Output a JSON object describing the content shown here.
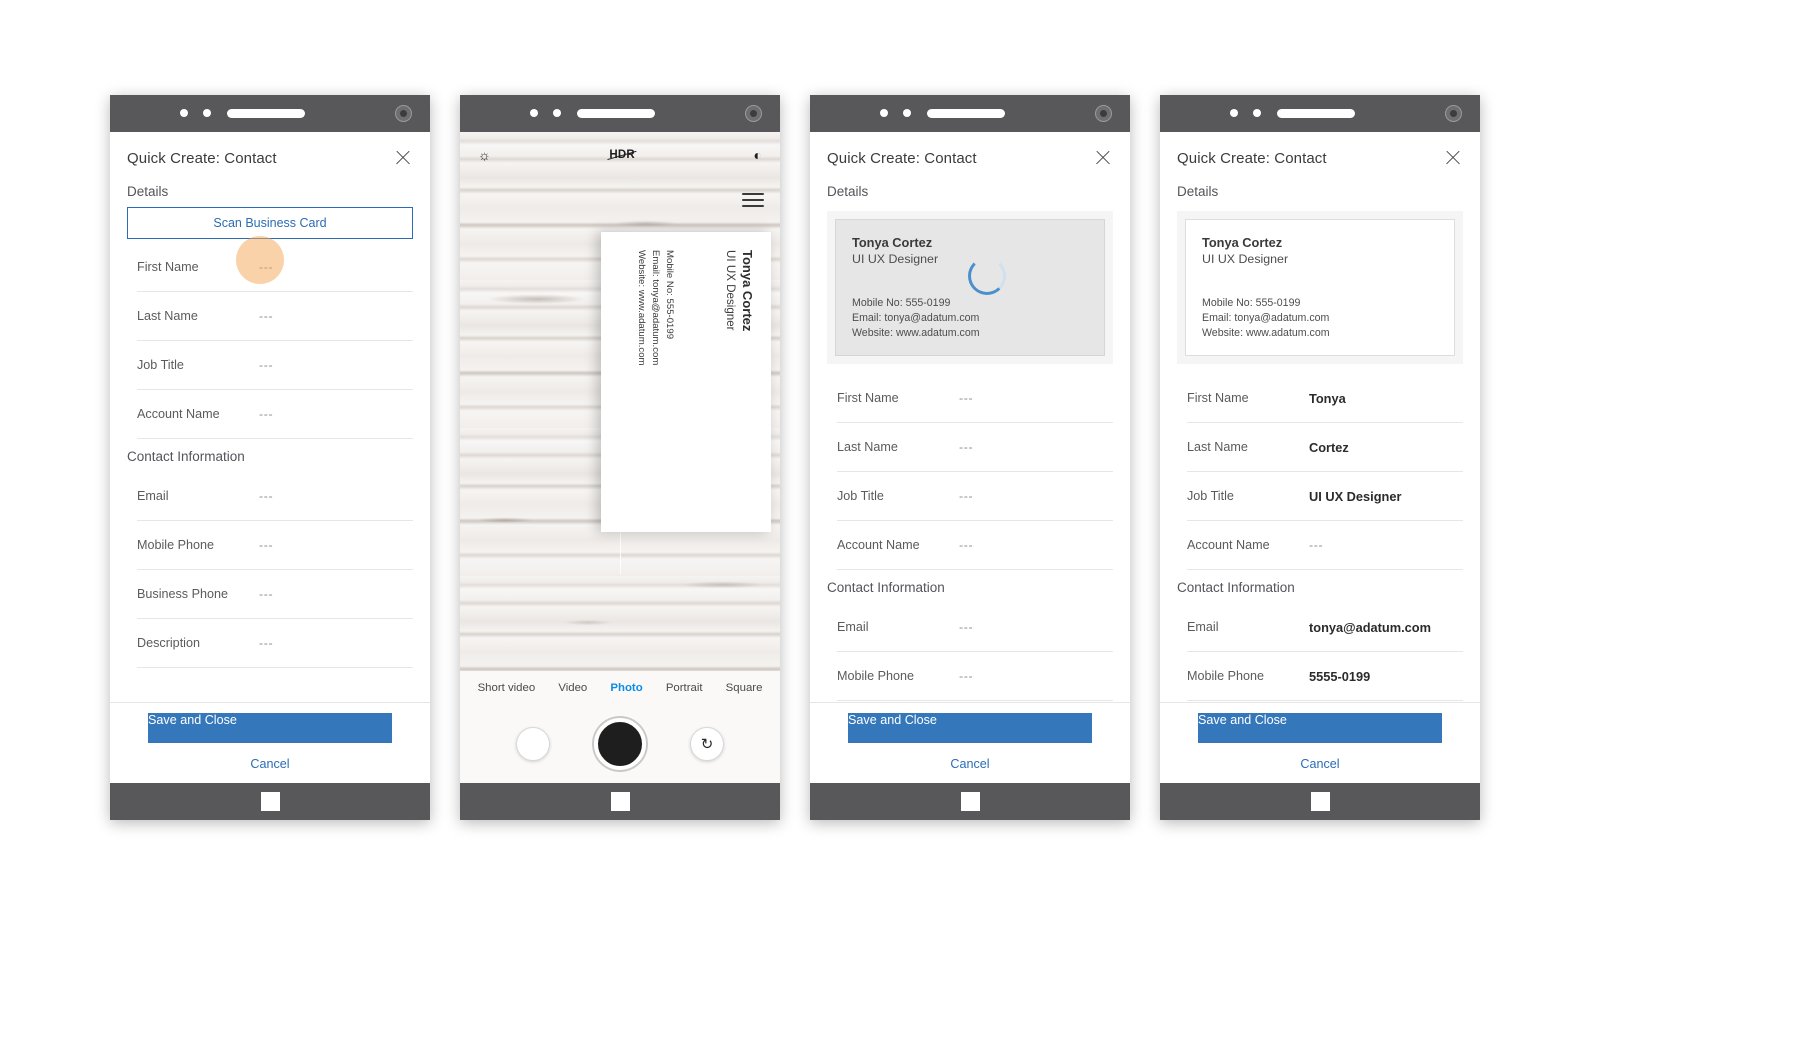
{
  "panels": [
    {
      "id": "panel-blank-form",
      "type": "form",
      "header": {
        "title": "Quick Create: Contact",
        "close_icon": "close-icon"
      },
      "details_label": "Details",
      "scan_button": "Scan Business Card",
      "has_tap_highlight": true,
      "fields": [
        {
          "label": "First Name",
          "value": "---",
          "filled": false
        },
        {
          "label": "Last Name",
          "value": "---",
          "filled": false
        },
        {
          "label": "Job Title",
          "value": "---",
          "filled": false
        },
        {
          "label": "Account Name",
          "value": "---",
          "filled": false
        }
      ],
      "contact_label": "Contact Information",
      "contact_fields": [
        {
          "label": "Email",
          "value": "---",
          "filled": false
        },
        {
          "label": "Mobile Phone",
          "value": "---",
          "filled": false
        },
        {
          "label": "Business Phone",
          "value": "---",
          "filled": false
        },
        {
          "label": "Description",
          "value": "---",
          "filled": false
        }
      ],
      "footer": {
        "save": "Save and Close",
        "cancel": "Cancel"
      }
    },
    {
      "id": "panel-camera",
      "type": "camera",
      "toolbar": {
        "brightness_icon": "brightness-sun-icon",
        "hdr_label": "HDR",
        "filter_icon": "color-filter-icon",
        "menu_icon": "hamburger-menu-icon"
      },
      "business_card": {
        "name": "Tonya Cortez",
        "role": "UI UX Designer",
        "mobile": "Mobile No: 555-0199",
        "email": "Email: tonya@adatum.com",
        "website": "Website: www.adatum.com"
      },
      "modes": [
        {
          "label": "Short video",
          "active": false
        },
        {
          "label": "Video",
          "active": false
        },
        {
          "label": "Photo",
          "active": true
        },
        {
          "label": "Portrait",
          "active": false
        },
        {
          "label": "Square",
          "active": false
        }
      ],
      "controls": {
        "gallery_icon": "gallery-thumbnail-icon",
        "shutter_icon": "shutter-button",
        "flip_icon": "flip-camera-icon"
      }
    },
    {
      "id": "panel-scanning",
      "type": "form",
      "header": {
        "title": "Quick Create: Contact",
        "close_icon": "close-icon"
      },
      "details_label": "Details",
      "card_preview": {
        "name": "Tonya Cortez",
        "role": "UI UX Designer",
        "mobile": "Mobile No: 555-0199",
        "email": "Email: tonya@adatum.com",
        "website": "Website: www.adatum.com",
        "loading": true,
        "style": "grey"
      },
      "fields": [
        {
          "label": "First Name",
          "value": "---",
          "filled": false
        },
        {
          "label": "Last Name",
          "value": "---",
          "filled": false
        },
        {
          "label": "Job Title",
          "value": "---",
          "filled": false
        },
        {
          "label": "Account Name",
          "value": "---",
          "filled": false
        }
      ],
      "contact_label": "Contact Information",
      "contact_fields": [
        {
          "label": "Email",
          "value": "---",
          "filled": false
        },
        {
          "label": "Mobile Phone",
          "value": "---",
          "filled": false
        }
      ],
      "footer": {
        "save": "Save and Close",
        "cancel": "Cancel"
      }
    },
    {
      "id": "panel-filled",
      "type": "form",
      "header": {
        "title": "Quick Create: Contact",
        "close_icon": "close-icon"
      },
      "details_label": "Details",
      "card_preview": {
        "name": "Tonya Cortez",
        "role": "UI UX Designer",
        "mobile": "Mobile No: 555-0199",
        "email": "Email: tonya@adatum.com",
        "website": "Website: www.adatum.com",
        "loading": false,
        "style": "white"
      },
      "fields": [
        {
          "label": "First Name",
          "value": "Tonya",
          "filled": true
        },
        {
          "label": "Last Name",
          "value": "Cortez",
          "filled": true
        },
        {
          "label": "Job Title",
          "value": "UI UX Designer",
          "filled": true
        },
        {
          "label": "Account Name",
          "value": "---",
          "filled": false
        }
      ],
      "contact_label": "Contact Information",
      "contact_fields": [
        {
          "label": "Email",
          "value": "tonya@adatum.com",
          "filled": true
        },
        {
          "label": "Mobile Phone",
          "value": "5555-0199",
          "filled": true
        }
      ],
      "footer": {
        "save": "Save and Close",
        "cancel": "Cancel"
      }
    }
  ],
  "colors": {
    "accent_blue": "#3577bb",
    "link_blue": "#2b6cb5",
    "active_mode_blue": "#0c8ce9",
    "phone_chrome": "#58585a",
    "highlight_orange": "#f3a95a"
  }
}
